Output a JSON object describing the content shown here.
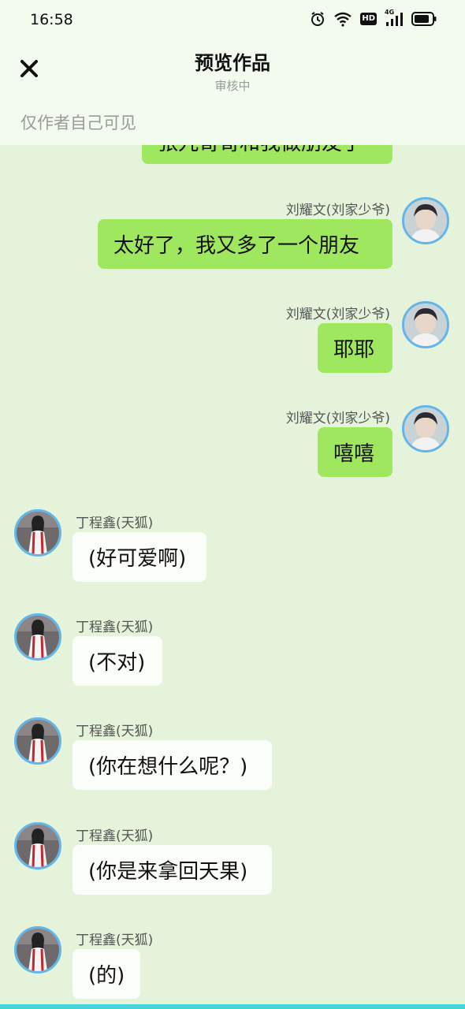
{
  "status_bar": {
    "time": "16:58",
    "icons": [
      "alarm-icon",
      "wifi-icon",
      "hd-icon",
      "signal-4g-icon",
      "battery-icon"
    ],
    "hd_text": "HD",
    "network_text": "4G"
  },
  "header": {
    "title": "预览作品",
    "subtitle": "审核中",
    "visibility_note": "仅作者自己可见"
  },
  "messages": [
    {
      "side": "right",
      "sender": "",
      "text": "张九哥哥和我做朋友了"
    },
    {
      "side": "right",
      "sender": "刘耀文(刘家少爷)",
      "text": "太好了，我又多了一个朋友"
    },
    {
      "side": "right",
      "sender": "刘耀文(刘家少爷)",
      "text": "耶耶"
    },
    {
      "side": "right",
      "sender": "刘耀文(刘家少爷)",
      "text": "嘻嘻"
    },
    {
      "side": "left",
      "sender": "丁程鑫(天狐)",
      "text": "(好可爱啊)"
    },
    {
      "side": "left",
      "sender": "丁程鑫(天狐)",
      "text": "(不对)"
    },
    {
      "side": "left",
      "sender": "丁程鑫(天狐)",
      "text": "(你在想什么呢？)"
    },
    {
      "side": "left",
      "sender": "丁程鑫(天狐)",
      "text": "(你是来拿回天果)"
    },
    {
      "side": "left",
      "sender": "丁程鑫(天狐)",
      "text": "(的)"
    }
  ],
  "colors": {
    "background": "#e4f3da",
    "header_bg": "#f2fbee",
    "right_bubble": "#9fe75f",
    "left_bubble": "#fbfdf9",
    "avatar_ring": "#63b6ea",
    "bottom_strip": "#48d3d8"
  }
}
